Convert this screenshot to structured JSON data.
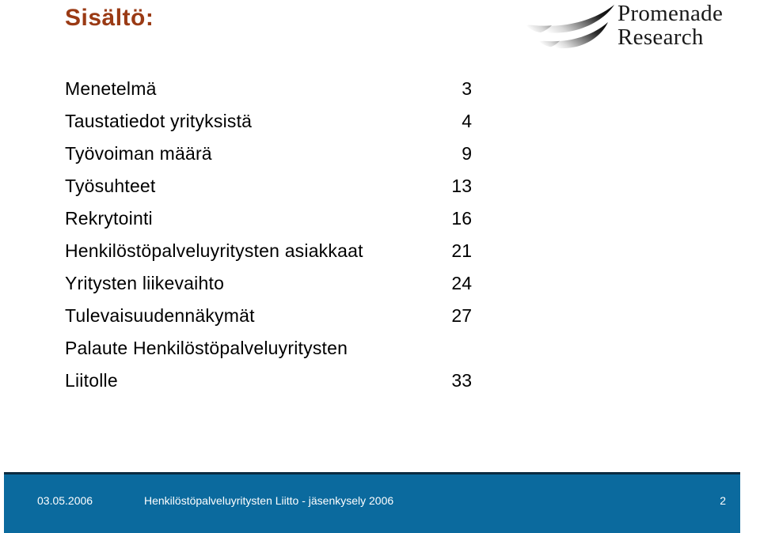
{
  "slide": {
    "title": "Sisältö:",
    "title_color": "#9A3A14",
    "background_color": "#ffffff"
  },
  "logo": {
    "mark_name": "promenade-swoosh-mark",
    "line1": "Promenade",
    "line2": "Research"
  },
  "toc": {
    "rows": [
      {
        "label": "Menetelmä",
        "page": "3"
      },
      {
        "label": "Taustatiedot yrityksistä",
        "page": "4"
      },
      {
        "label": "Työvoiman määrä",
        "page": "9"
      },
      {
        "label": "Työsuhteet",
        "page": "13"
      },
      {
        "label": "Rekrytointi",
        "page": "16"
      },
      {
        "label": "Henkilöstöpalveluyritysten asiakkaat",
        "page": "21"
      },
      {
        "label": "Yritysten liikevaihto",
        "page": "24"
      },
      {
        "label": "Tulevaisuudennäkymät",
        "page": "27"
      },
      {
        "label": "Palaute Henkilöstöpalveluyritysten",
        "page": ""
      },
      {
        "label": "Liitolle",
        "page": "33"
      }
    ]
  },
  "footer": {
    "date": "03.05.2006",
    "title": "Henkilöstöpalveluyritysten Liitto - jäsenkysely 2006",
    "page_number": "2",
    "background_color": "#0B6A9E",
    "top_rule_color": "#0B2B40",
    "text_color": "#ffffff"
  }
}
